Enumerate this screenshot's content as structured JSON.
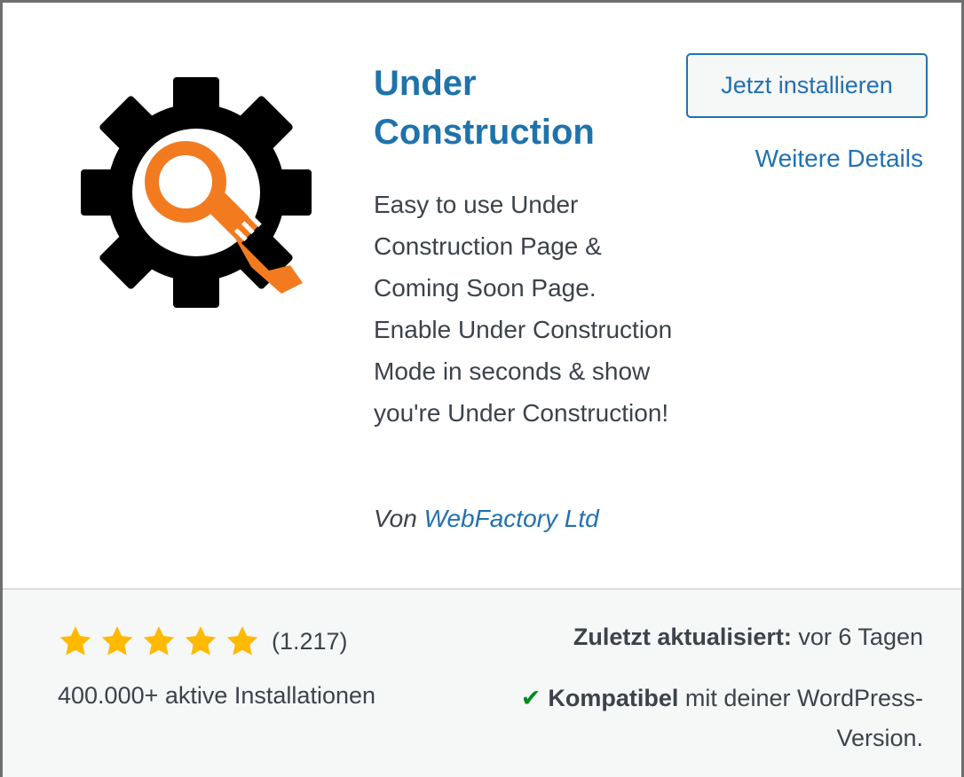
{
  "plugin": {
    "title": "Under Construction",
    "install_label": "Jetzt installieren",
    "details_label": "Weitere Details",
    "description": "Easy to use Under Construction Page & Coming Soon Page. Enable Under Construction Mode in seconds & show you're Under Construction!",
    "author_prefix": "Von",
    "author_name": "WebFactory Ltd",
    "icon": "gear-wrench-icon"
  },
  "footer": {
    "rating_stars": 5,
    "rating_max": 5,
    "rating_count": "(1.217)",
    "active_installs": "400.000+ aktive Installationen",
    "last_updated_label": "Zuletzt aktualisiert:",
    "last_updated_value": "vor 6 Tagen",
    "compat_label": "Kompatibel",
    "compat_text": "mit deiner WordPress-Version."
  },
  "colors": {
    "link": "#2271b1",
    "title": "#1f73aa",
    "star": "#ffb900",
    "gear": "#000000",
    "accent_orange": "#f27b20",
    "check": "#008a20"
  }
}
